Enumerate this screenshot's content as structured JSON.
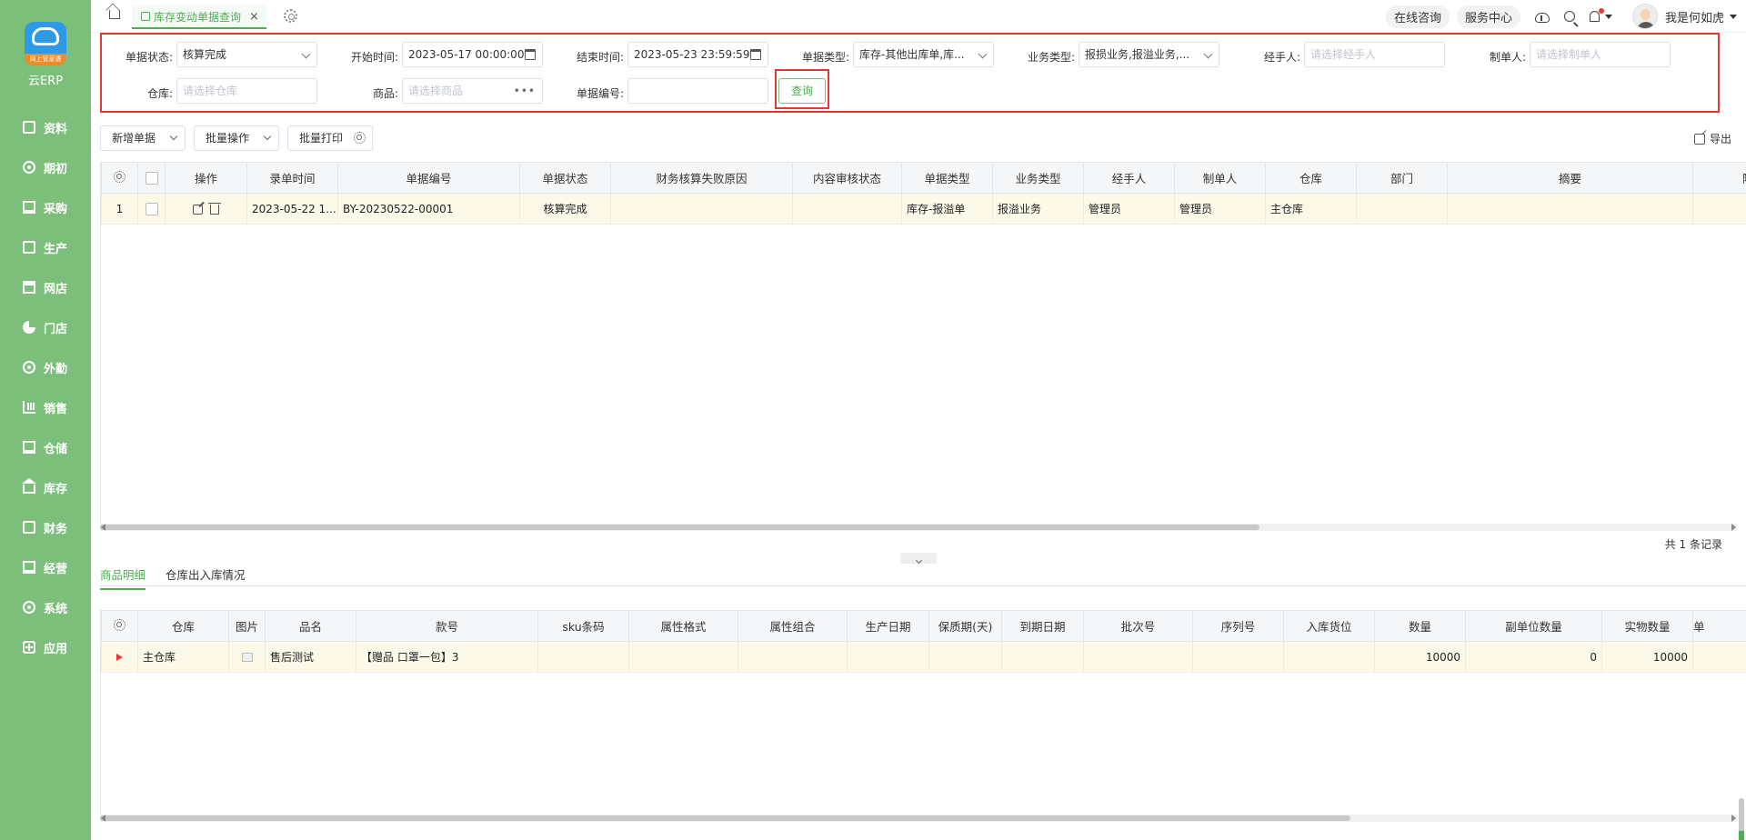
{
  "app": {
    "name": "云ERP",
    "logo_tag": "网上管家婆"
  },
  "sidebar": {
    "items": [
      {
        "label": "资料",
        "icon": "document-icon"
      },
      {
        "label": "期初",
        "icon": "circle-icon"
      },
      {
        "label": "采购",
        "icon": "screen-icon"
      },
      {
        "label": "生产",
        "icon": "box-icon"
      },
      {
        "label": "网店",
        "icon": "store-icon"
      },
      {
        "label": "门店",
        "icon": "pie-icon"
      },
      {
        "label": "外勤",
        "icon": "target-icon"
      },
      {
        "label": "销售",
        "icon": "bars-icon"
      },
      {
        "label": "仓储",
        "icon": "warehouse-icon"
      },
      {
        "label": "库存",
        "icon": "house-icon"
      },
      {
        "label": "财务",
        "icon": "finance-icon"
      },
      {
        "label": "经营",
        "icon": "operate-icon"
      },
      {
        "label": "系统",
        "icon": "system-icon"
      },
      {
        "label": "应用",
        "icon": "plus-icon"
      }
    ]
  },
  "topbar": {
    "tab_label": "库存变动单据查询",
    "tab_close": "×",
    "consult": "在线咨询",
    "service": "服务中心",
    "username": "我是何如虎"
  },
  "filters": {
    "status_label": "单据状态:",
    "status_value": "核算完成",
    "start_label": "开始时间:",
    "start_value": "2023-05-17 00:00:00",
    "end_label": "结束时间:",
    "end_value": "2023-05-23 23:59:59",
    "doctype_label": "单据类型:",
    "doctype_value": "库存-其他出库单,库...",
    "biztype_label": "业务类型:",
    "biztype_value": "报损业务,报溢业务,...",
    "handler_label": "经手人:",
    "handler_placeholder": "请选择经手人",
    "maker_label": "制单人:",
    "maker_placeholder": "请选择制单人",
    "warehouse_label": "仓库:",
    "warehouse_placeholder": "请选择仓库",
    "product_label": "商品:",
    "product_placeholder": "请选择商品",
    "docno_label": "单据编号:",
    "docno_value": "",
    "query_button": "查询"
  },
  "toolbar": {
    "new_doc": "新增单据",
    "batch_ops": "批量操作",
    "batch_print": "批量打印",
    "export": "导出"
  },
  "main_table": {
    "columns": [
      "操作",
      "录单时间",
      "单据编号",
      "单据状态",
      "财务核算失败原因",
      "内容审核状态",
      "单据类型",
      "业务类型",
      "经手人",
      "制单人",
      "仓库",
      "部门",
      "摘要",
      "附加"
    ],
    "rows": [
      {
        "index": "1",
        "time": "2023-05-22 1...",
        "docno": "BY-20230522-00001",
        "status": "核算完成",
        "fail_reason": "",
        "audit_status": "",
        "doctype": "库存-报溢单",
        "biztype": "报溢业务",
        "handler": "管理员",
        "maker": "管理员",
        "warehouse": "主仓库",
        "dept": "",
        "summary": "",
        "extra": ""
      }
    ],
    "record_count": "共 1 条记录"
  },
  "bottom_tabs": [
    "商品明细",
    "仓库出入库情况"
  ],
  "detail_table": {
    "columns": [
      "仓库",
      "图片",
      "品名",
      "款号",
      "sku条码",
      "属性格式",
      "属性组合",
      "生产日期",
      "保质期(天)",
      "到期日期",
      "批次号",
      "序列号",
      "入库货位",
      "数量",
      "副单位数量",
      "实物数量",
      "单"
    ],
    "rows": [
      {
        "warehouse": "主仓库",
        "name": "售后测试",
        "style": "【赠品 口罩一包】3",
        "qty": "10000",
        "sub_qty": "0",
        "real_qty": "10000"
      }
    ]
  },
  "colors": {
    "sidebar": "#7cbf7b",
    "accent": "#4caf50",
    "highlight": "#e53935",
    "row": "#fdf9e8"
  }
}
